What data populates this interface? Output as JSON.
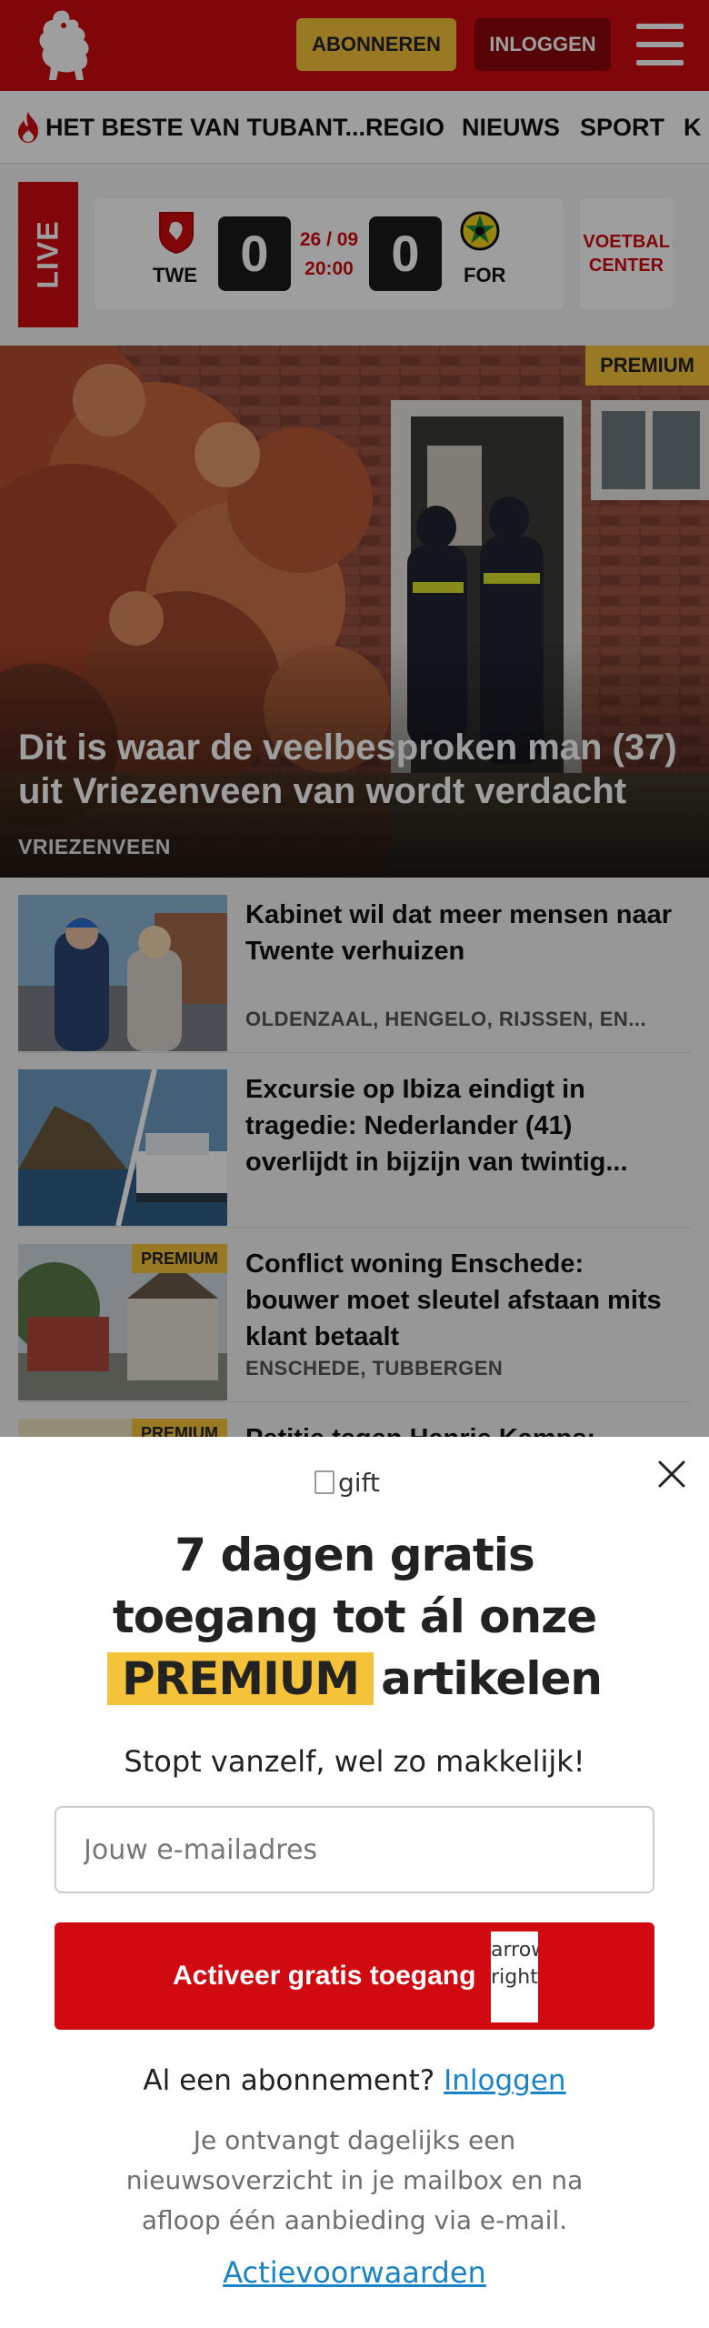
{
  "header": {
    "subscribe_label": "ABONNEREN",
    "login_label": "INLOGGEN",
    "brand_color": "#d10a11"
  },
  "nav": {
    "items": [
      {
        "label": "HET BESTE VAN TUBANT..."
      },
      {
        "label": "REGIO"
      },
      {
        "label": "NIEUWS"
      },
      {
        "label": "SPORT"
      },
      {
        "label": "K"
      }
    ]
  },
  "live": {
    "label": "LIVE",
    "home_team": "TWE",
    "away_team": "FOR",
    "home_score": "0",
    "away_score": "0",
    "date": "26 / 09",
    "time": "20:00",
    "voetbal_center": "VOETBAL CENTER"
  },
  "hero": {
    "badge": "PREMIUM",
    "title": "Dit is waar de veelbesproken man (37) uit Vriezenveen van wordt verdacht",
    "location": "VRIEZENVEEN"
  },
  "articles": [
    {
      "title": "Kabinet wil dat meer mensen naar Twente verhuizen",
      "location": "OLDENZAAL, HENGELO, RIJSSEN, EN..."
    },
    {
      "title": "Excursie op Ibiza eindigt in tragedie: Nederlander (41) overlijdt in bijzijn van twintig...",
      "location": ""
    },
    {
      "title": "Conflict woning Enschede: bouwer moet sleutel afstaan mits klant betaalt",
      "location": "ENSCHEDE, TUBBERGEN",
      "badge": "PREMIUM"
    },
    {
      "title": "Petitie tegen Henrie Kamps:",
      "location": "",
      "badge": "PREMIUM"
    }
  ],
  "modal": {
    "gift_alt": "gift",
    "headline_1": "7 dagen gratis",
    "headline_2": "toegang tot ál onze",
    "headline_premium": "PREMIUM",
    "headline_3": "artikelen",
    "subline": "Stopt vanzelf, wel zo makkelijk!",
    "email_placeholder": "Jouw e-mailadres",
    "cta_label": "Activeer gratis toegang",
    "cta_arrow_alt": "arrow right",
    "already_text": "Al een abonnement?",
    "login_link": "Inloggen",
    "info": "Je ontvangt dagelijks een nieuwsoverzicht in je mailbox en na afloop één aanbieding via e-mail.",
    "terms_link": "Actievoorwaarden"
  }
}
